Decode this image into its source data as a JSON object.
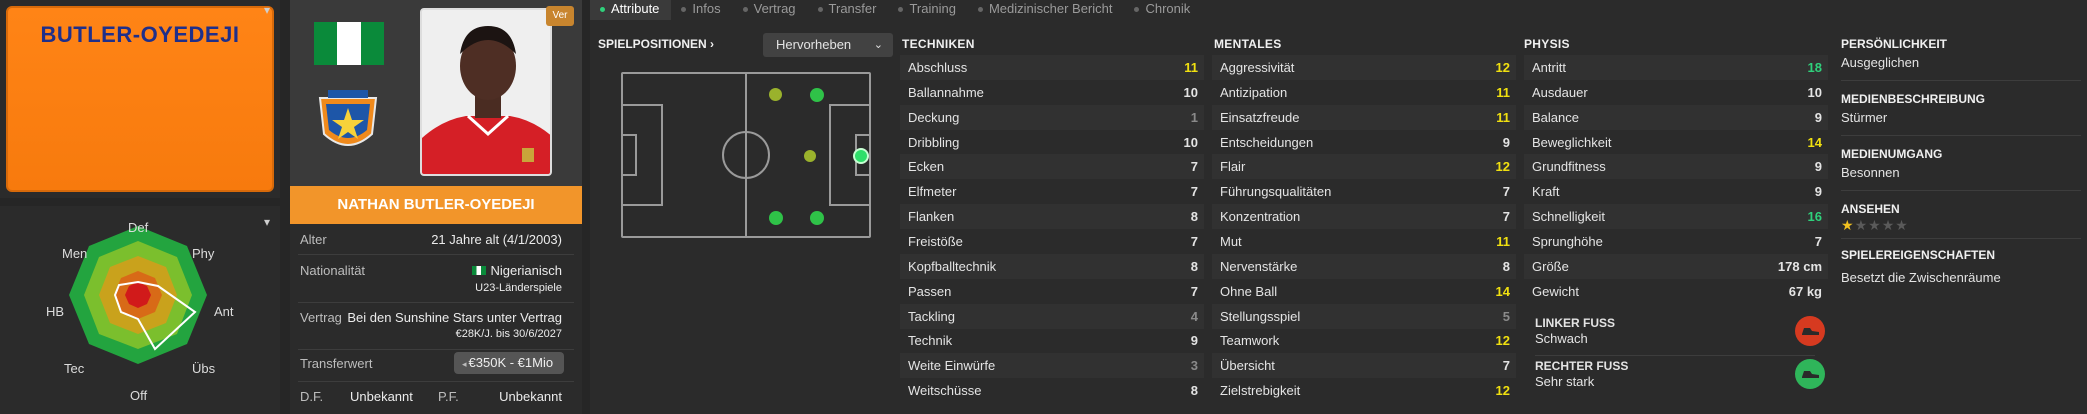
{
  "kit": {
    "name": "BUTLER-OYEDEJI"
  },
  "radar": {
    "labels": {
      "def": "Def",
      "phy": "Phy",
      "ant": "Ant",
      "ubs": "Übs",
      "off": "Off",
      "tec": "Tec",
      "hb": "HB",
      "men": "Men"
    }
  },
  "profile": {
    "ver_label": "Ver",
    "player_name": "NATHAN BUTLER-OYEDEJI",
    "rows": {
      "alter_label": "Alter",
      "alter_value": "21 Jahre alt  (4/1/2003)",
      "nation_label": "Nationalität",
      "nation_value": "Nigerianisch",
      "nation_sub": "U23-Länderspiele",
      "vertrag_label": "Vertrag",
      "vertrag_value": "Bei den Sunshine Stars unter Vertrag",
      "vertrag_sub": "€28K/J. bis 30/6/2027",
      "transfer_label": "Transferwert",
      "transfer_value": "€350K - €1Mio",
      "df_label": "D.F.",
      "df_value": "Unbekannt",
      "pf_label": "P.F.",
      "pf_value": "Unbekannt"
    },
    "flag_colors": [
      "#0a8a3a",
      "#ffffff",
      "#0a8a3a"
    ]
  },
  "tabs": [
    "Attribute",
    "Infos",
    "Vertrag",
    "Transfer",
    "Training",
    "Medizinischer Bericht",
    "Chronik"
  ],
  "positions": {
    "label": "SPIELPOSITIONEN",
    "highlight": "Hervorheben"
  },
  "columns": {
    "tech": "TECHNIKEN",
    "ment": "MENTALES",
    "phys": "PHYSIS"
  },
  "techniken": [
    {
      "name": "Abschluss",
      "value": "11",
      "c": "y"
    },
    {
      "name": "Ballannahme",
      "value": "10",
      "c": "w"
    },
    {
      "name": "Deckung",
      "value": "1",
      "c": "m"
    },
    {
      "name": "Dribbling",
      "value": "10",
      "c": "w"
    },
    {
      "name": "Ecken",
      "value": "7",
      "c": "w"
    },
    {
      "name": "Elfmeter",
      "value": "7",
      "c": "w"
    },
    {
      "name": "Flanken",
      "value": "8",
      "c": "w"
    },
    {
      "name": "Freistöße",
      "value": "7",
      "c": "w"
    },
    {
      "name": "Kopfballtechnik",
      "value": "8",
      "c": "w"
    },
    {
      "name": "Passen",
      "value": "7",
      "c": "w"
    },
    {
      "name": "Tackling",
      "value": "4",
      "c": "m"
    },
    {
      "name": "Technik",
      "value": "9",
      "c": "w"
    },
    {
      "name": "Weite Einwürfe",
      "value": "3",
      "c": "m"
    },
    {
      "name": "Weitschüsse",
      "value": "8",
      "c": "w"
    }
  ],
  "mentales": [
    {
      "name": "Aggressivität",
      "value": "12",
      "c": "y"
    },
    {
      "name": "Antizipation",
      "value": "11",
      "c": "y"
    },
    {
      "name": "Einsatzfreude",
      "value": "11",
      "c": "y"
    },
    {
      "name": "Entscheidungen",
      "value": "9",
      "c": "w"
    },
    {
      "name": "Flair",
      "value": "12",
      "c": "y"
    },
    {
      "name": "Führungsqualitäten",
      "value": "7",
      "c": "w"
    },
    {
      "name": "Konzentration",
      "value": "7",
      "c": "w"
    },
    {
      "name": "Mut",
      "value": "11",
      "c": "y"
    },
    {
      "name": "Nervenstärke",
      "value": "8",
      "c": "w"
    },
    {
      "name": "Ohne Ball",
      "value": "14",
      "c": "y"
    },
    {
      "name": "Stellungsspiel",
      "value": "5",
      "c": "m"
    },
    {
      "name": "Teamwork",
      "value": "12",
      "c": "y"
    },
    {
      "name": "Übersicht",
      "value": "7",
      "c": "w"
    },
    {
      "name": "Zielstrebigkeit",
      "value": "12",
      "c": "y"
    }
  ],
  "physis": [
    {
      "name": "Antritt",
      "value": "18",
      "c": "g"
    },
    {
      "name": "Ausdauer",
      "value": "10",
      "c": "w"
    },
    {
      "name": "Balance",
      "value": "9",
      "c": "w"
    },
    {
      "name": "Beweglichkeit",
      "value": "14",
      "c": "y"
    },
    {
      "name": "Grundfitness",
      "value": "9",
      "c": "w"
    },
    {
      "name": "Kraft",
      "value": "9",
      "c": "w"
    },
    {
      "name": "Schnelligkeit",
      "value": "16",
      "c": "g"
    },
    {
      "name": "Sprunghöhe",
      "value": "7",
      "c": "w"
    },
    {
      "name": "Größe",
      "value": "178 cm",
      "c": "w"
    },
    {
      "name": "Gewicht",
      "value": "67 kg",
      "c": "w"
    }
  ],
  "feet": {
    "left_label": "LINKER FUSS",
    "left_value": "Schwach",
    "left_color": "#d63a20",
    "right_label": "RECHTER FUSS",
    "right_value": "Sehr stark",
    "right_color": "#2fb55a"
  },
  "personality": {
    "p_label": "PERSÖNLICHKEIT",
    "p_value": "Ausgeglichen",
    "m_label": "MEDIENBESCHREIBUNG",
    "m_value": "Stürmer",
    "u_label": "MEDIENUMGANG",
    "u_value": "Besonnen",
    "a_label": "ANSEHEN",
    "a_stars": 1,
    "a_max": 5,
    "e_label": "SPIELEREIGENSCHAFTEN",
    "e_value": "Besetzt die Zwischenräume"
  }
}
